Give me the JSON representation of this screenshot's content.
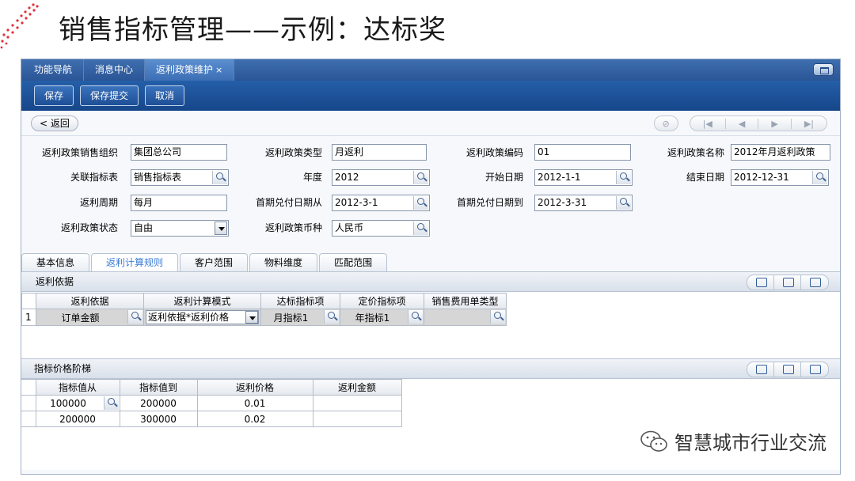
{
  "slide": {
    "title": "销售指标管理——示例：达标奖",
    "watermark": "智慧城市行业交流"
  },
  "tabs": [
    {
      "label": "功能导航"
    },
    {
      "label": "消息中心"
    },
    {
      "label": "返利政策维护",
      "close": "×"
    }
  ],
  "toolbar": {
    "save": "保存",
    "save_submit": "保存提交",
    "cancel": "取消"
  },
  "nav": {
    "back": "< 返回"
  },
  "form": {
    "sales_org": {
      "label": "返利政策销售组织",
      "value": "集团总公司"
    },
    "policy_type": {
      "label": "返利政策类型",
      "value": "月返利"
    },
    "policy_code": {
      "label": "返利政策编码",
      "value": "01"
    },
    "policy_name": {
      "label": "返利政策名称",
      "value": "2012年月返利政策"
    },
    "indicator_table": {
      "label": "关联指标表",
      "value": "销售指标表"
    },
    "year": {
      "label": "年度",
      "value": "2012"
    },
    "start_date": {
      "label": "开始日期",
      "value": "2012-1-1"
    },
    "end_date": {
      "label": "结束日期",
      "value": "2012-12-31"
    },
    "cycle": {
      "label": "返利周期",
      "value": "每月"
    },
    "first_pay_from": {
      "label": "首期兑付日期从",
      "value": "2012-3-1"
    },
    "first_pay_to": {
      "label": "首期兑付日期到",
      "value": "2012-3-31"
    },
    "status": {
      "label": "返利政策状态",
      "value": "自由"
    },
    "currency": {
      "label": "返利政策币种",
      "value": "人民币"
    }
  },
  "subtabs": [
    "基本信息",
    "返利计算规则",
    "客户范围",
    "物料维度",
    "匹配范围"
  ],
  "basis_panel": {
    "title": "返利依据",
    "columns": [
      "返利依据",
      "返利计算模式",
      "达标指标项",
      "定价指标项",
      "销售费用单类型"
    ],
    "rows": [
      {
        "index": "1",
        "basis": "订单金额",
        "mode": "返利依据*返利价格",
        "target_item": "月指标1",
        "price_item": "年指标1",
        "expense_type": ""
      }
    ]
  },
  "ladder_panel": {
    "title": "指标价格阶梯",
    "columns": [
      "指标值从",
      "指标值到",
      "返利价格",
      "返利金额"
    ],
    "rows": [
      {
        "from": "100000",
        "to": "200000",
        "price": "0.01",
        "amount": ""
      },
      {
        "from": "200000",
        "to": "300000",
        "price": "0.02",
        "amount": ""
      }
    ]
  }
}
